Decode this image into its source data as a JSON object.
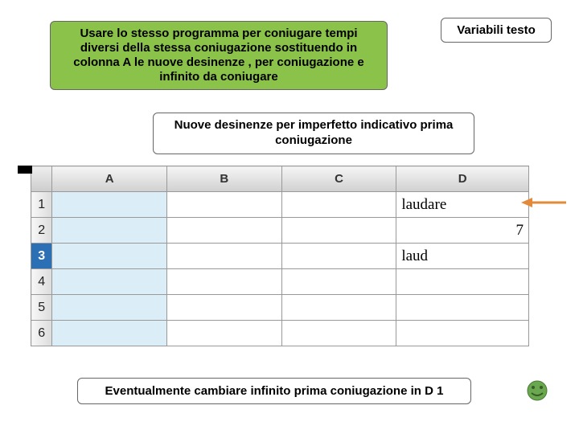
{
  "title_box": "Usare lo stesso programma per coniugare tempi diversi della stessa coniugazione sostituendo in colonna A le nuove desinenze , per coniugazione e infinito da coniugare",
  "top_right": "Variabili testo",
  "subtitle": "Nuove desinenze per imperfetto indicativo prima coniugazione",
  "sheet": {
    "cols": [
      "A",
      "B",
      "C",
      "D"
    ],
    "rows": [
      "1",
      "2",
      "3",
      "4",
      "5",
      "6"
    ],
    "d1": "laudare",
    "d2": "7",
    "d3": "laud"
  },
  "bottom": "Eventualmente cambiare infinito prima coniugazione in D 1"
}
